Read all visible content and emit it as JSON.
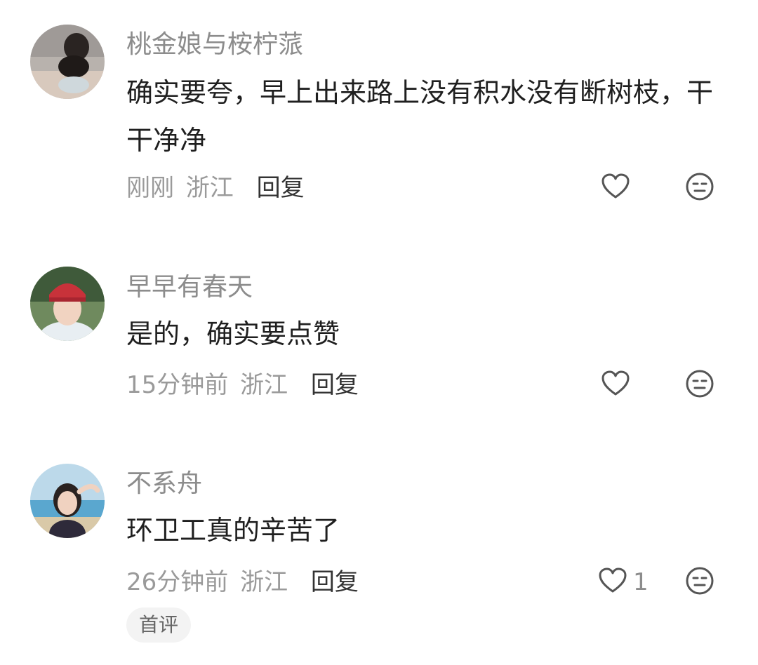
{
  "comments": [
    {
      "username": "桃金娘与桉柠蒎",
      "text": "确实要夸，早上出来路上没有积水没有断树枝，干干净净",
      "time": "刚刚",
      "location": "浙江",
      "reply_label": "回复",
      "like_count": ""
    },
    {
      "username": "早早有春天",
      "text": "是的，确实要点赞",
      "time": "15分钟前",
      "location": "浙江",
      "reply_label": "回复",
      "like_count": ""
    },
    {
      "username": "不系舟",
      "text": "环卫工真的辛苦了",
      "time": "26分钟前",
      "location": "浙江",
      "reply_label": "回复",
      "like_count": "1",
      "badge": "首评"
    }
  ],
  "icons": {
    "like": "heart-outline-icon",
    "emoji": "expressionless-face-icon"
  },
  "colors": {
    "username": "#8c8c8c",
    "text": "#1f1f1f",
    "meta": "#9a9a9a",
    "reply": "#333333",
    "icon": "#555555",
    "badge_bg": "#f3f3f3"
  }
}
